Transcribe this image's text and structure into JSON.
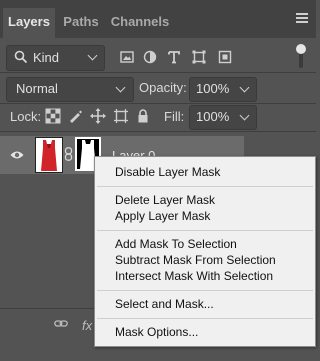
{
  "tabs": [
    {
      "label": "Layers",
      "active": true
    },
    {
      "label": "Paths",
      "active": false
    },
    {
      "label": "Channels",
      "active": false
    }
  ],
  "filter": {
    "kind_label": "Kind",
    "icons": [
      "pixel-layer-filter-icon",
      "adjustment-layer-filter-icon",
      "type-layer-filter-icon",
      "shape-layer-filter-icon",
      "smart-object-filter-icon"
    ]
  },
  "blend": {
    "mode": "Normal",
    "opacity_label": "Opacity:",
    "opacity_value": "100%"
  },
  "lock": {
    "label": "Lock:",
    "icons": [
      "lock-transparent-icon",
      "lock-pixels-icon",
      "lock-position-icon",
      "lock-artboard-icon",
      "lock-all-icon"
    ],
    "fill_label": "Fill:",
    "fill_value": "100%"
  },
  "layer": {
    "name": "Layer 0",
    "thumbnail_color": "#d0232a"
  },
  "context_menu": {
    "items": [
      "Disable Layer Mask",
      "Delete Layer Mask",
      "Apply Layer Mask",
      "Add Mask To Selection",
      "Subtract Mask From Selection",
      "Intersect Mask With Selection",
      "Select and Mask...",
      "Mask Options..."
    ]
  },
  "bottom_bar": {
    "fx_label": "fx",
    "icons": [
      "link-layers-icon",
      "layer-style-icon"
    ]
  },
  "colors": {
    "panel_bg": "#535353",
    "tab_bar_bg": "#424242",
    "selected_row": "#6b6b6b",
    "menu_bg": "#f0f0f0"
  }
}
